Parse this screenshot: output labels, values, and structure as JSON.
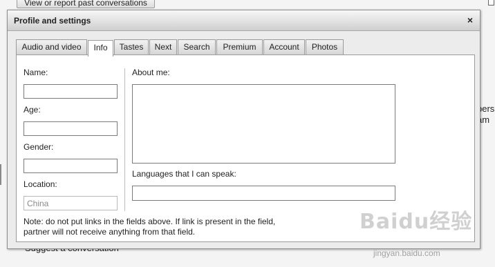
{
  "background": {
    "top_button_label": "View or report past conversations",
    "right_text_line1": "pers",
    "right_text_line2": "am",
    "bottom_text": "Suggest a conversation"
  },
  "dialog": {
    "title": "Profile and settings",
    "close_glyph": "×"
  },
  "tabs": [
    {
      "label": "Audio and video",
      "active": false
    },
    {
      "label": "Info",
      "active": true
    },
    {
      "label": "Tastes",
      "active": false
    },
    {
      "label": "Next",
      "active": false
    },
    {
      "label": "Search",
      "active": false
    },
    {
      "label": "Premium",
      "active": false
    },
    {
      "label": "Account",
      "active": false
    },
    {
      "label": "Photos",
      "active": false
    }
  ],
  "form": {
    "name_label": "Name:",
    "name_value": "",
    "age_label": "Age:",
    "age_value": "",
    "gender_label": "Gender:",
    "gender_value": "",
    "location_label": "Location:",
    "location_value": "China",
    "about_label": "About me:",
    "about_value": "",
    "languages_label": "Languages that I can speak:",
    "languages_value": ""
  },
  "note": {
    "line1": "Note: do not put links in the fields above. If link is present in the field,",
    "line2": "partner will not receive anything from that field."
  },
  "watermark": {
    "logo": "Baidu经验",
    "url": "jingyan.baidu.com"
  }
}
